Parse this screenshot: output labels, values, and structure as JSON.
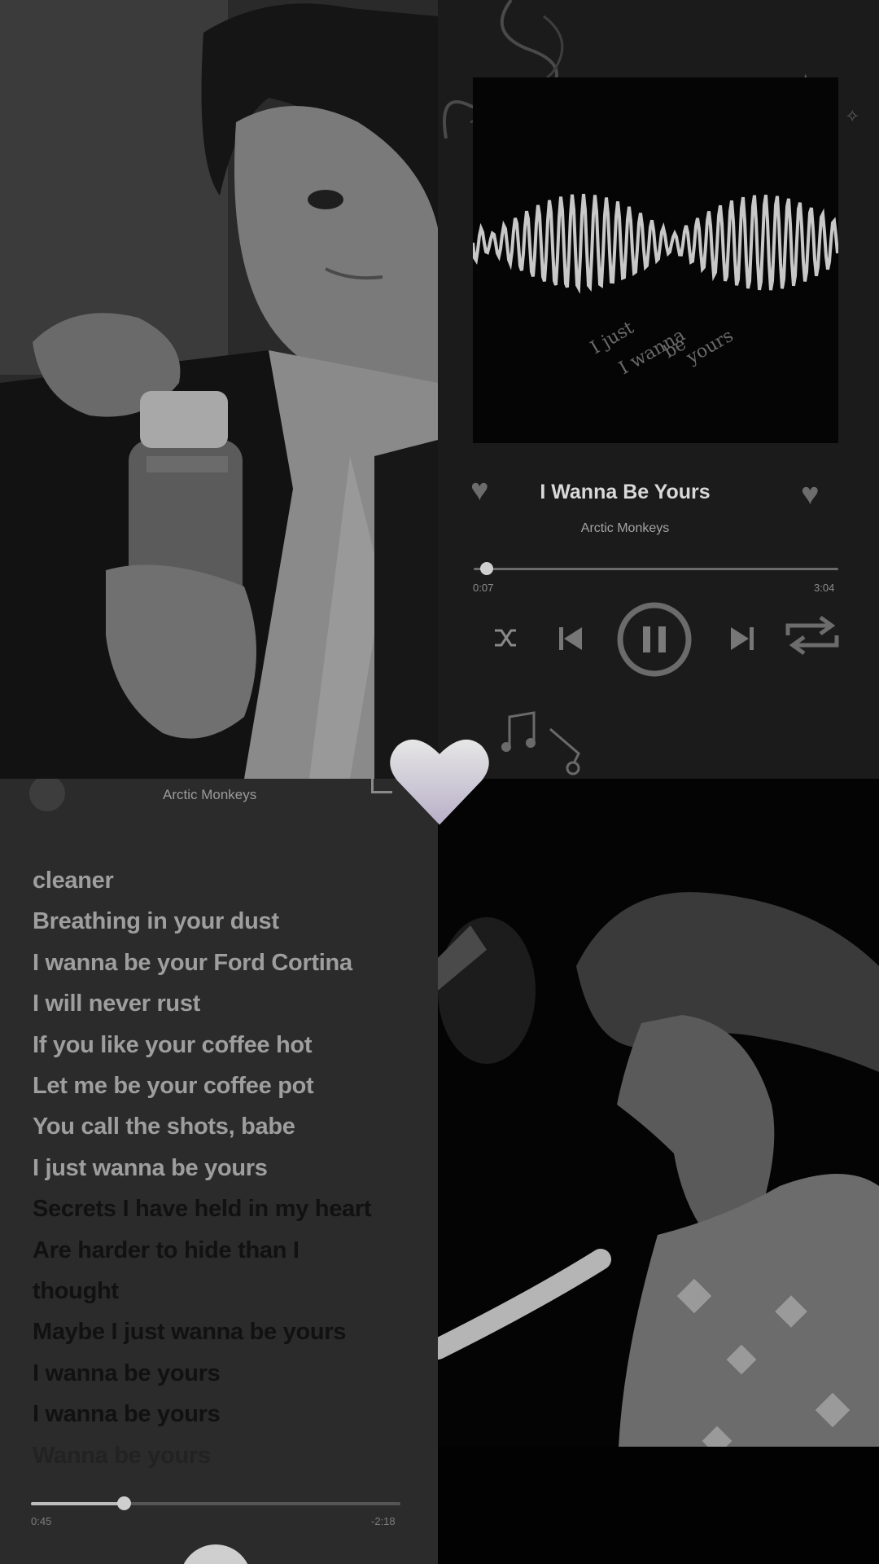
{
  "player": {
    "song_title": "I Wanna Be Yours",
    "artist": "Arctic Monkeys",
    "cover_handwriting": [
      "I just",
      "I wanna",
      "be",
      "yours"
    ],
    "elapsed": "0:07",
    "duration": "3:04",
    "progress_fraction": 0.04,
    "icons": [
      "heart-icon",
      "shuffle-icon",
      "previous-icon",
      "pause-icon",
      "next-icon",
      "repeat-icon",
      "music-notes-icon"
    ]
  },
  "lyrics_screen": {
    "artist": "Arctic Monkeys",
    "lines": [
      {
        "text": "cleaner",
        "state": "sung"
      },
      {
        "text": "Breathing in your dust",
        "state": "sung"
      },
      {
        "text": "I wanna be your Ford Cortina",
        "state": "sung"
      },
      {
        "text": "I will never rust",
        "state": "sung"
      },
      {
        "text": "If you like your coffee hot",
        "state": "sung"
      },
      {
        "text": "Let me be your coffee pot",
        "state": "sung"
      },
      {
        "text": "You call the shots, babe",
        "state": "sung"
      },
      {
        "text": "I just wanna be yours",
        "state": "sung"
      },
      {
        "text": "Secrets I have held in my heart",
        "state": "next"
      },
      {
        "text": "Are harder to hide than I",
        "state": "next"
      },
      {
        "text": "thought",
        "state": "next"
      },
      {
        "text": "Maybe I just wanna be yours",
        "state": "next"
      },
      {
        "text": "I wanna be yours",
        "state": "next"
      },
      {
        "text": "I wanna be yours",
        "state": "next"
      },
      {
        "text": "Wanna be yours",
        "state": "faded"
      }
    ],
    "elapsed": "0:45",
    "remaining": "-2:18",
    "progress_fraction": 0.25
  },
  "colors": {
    "accent_heart": "#c9c3d6",
    "lyric_sung": "#9e9e9e",
    "lyric_upcoming": "#111111"
  }
}
